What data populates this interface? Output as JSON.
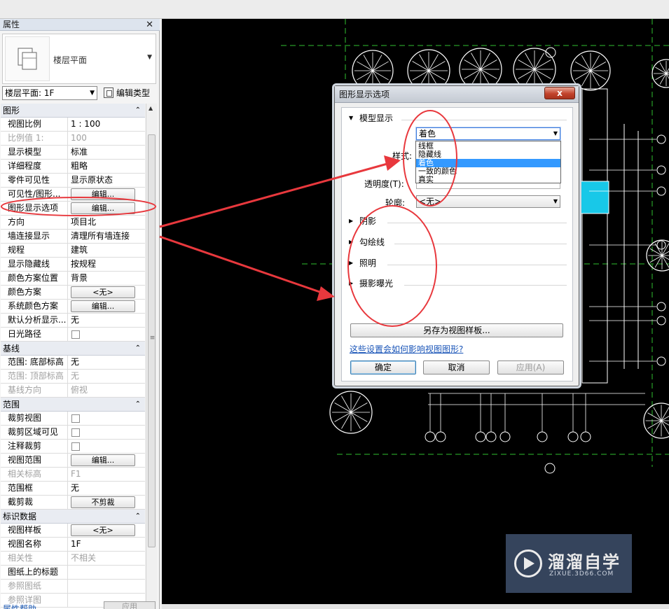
{
  "properties": {
    "title": "属性",
    "type_name": "楼层平面",
    "view_selector": "楼层平面: 1F",
    "edit_type_label": "编辑类型",
    "sections": [
      {
        "title": "图形",
        "rows": [
          {
            "label": "视图比例",
            "value": "1 : 100"
          },
          {
            "label": "比例值 1:",
            "value": "100",
            "disabled": true
          },
          {
            "label": "显示模型",
            "value": "标准"
          },
          {
            "label": "详细程度",
            "value": "粗略"
          },
          {
            "label": "零件可见性",
            "value": "显示原状态"
          },
          {
            "label": "可见性/图形...",
            "button": "编辑..."
          },
          {
            "label": "图形显示选项",
            "button": "编辑..."
          },
          {
            "label": "方向",
            "value": "项目北"
          },
          {
            "label": "墙连接显示",
            "value": "清理所有墙连接"
          },
          {
            "label": "规程",
            "value": "建筑"
          },
          {
            "label": "显示隐藏线",
            "value": "按规程"
          },
          {
            "label": "颜色方案位置",
            "value": "背景"
          },
          {
            "label": "颜色方案",
            "button": "<无>"
          },
          {
            "label": "系统颜色方案",
            "button": "编辑..."
          },
          {
            "label": "默认分析显示...",
            "value": "无"
          },
          {
            "label": "日光路径",
            "checkbox": true
          }
        ]
      },
      {
        "title": "基线",
        "rows": [
          {
            "label": "范围: 底部标高",
            "value": "无"
          },
          {
            "label": "范围: 顶部标高",
            "value": "无",
            "disabled": true
          },
          {
            "label": "基线方向",
            "value": "俯视",
            "disabled": true
          }
        ]
      },
      {
        "title": "范围",
        "rows": [
          {
            "label": "裁剪视图",
            "checkbox": true
          },
          {
            "label": "裁剪区域可见",
            "checkbox": true
          },
          {
            "label": "注释裁剪",
            "checkbox": true
          },
          {
            "label": "视图范围",
            "button": "编辑..."
          },
          {
            "label": "相关标高",
            "value": "F1",
            "disabled": true
          },
          {
            "label": "范围框",
            "value": "无"
          },
          {
            "label": "截剪裁",
            "button": "不剪裁"
          }
        ]
      },
      {
        "title": "标识数据",
        "rows": [
          {
            "label": "视图样板",
            "button": "<无>"
          },
          {
            "label": "视图名称",
            "value": "1F"
          },
          {
            "label": "相关性",
            "value": "不相关",
            "disabled": true
          },
          {
            "label": "图纸上的标题",
            "value": ""
          },
          {
            "label": "参照图纸",
            "value": "",
            "disabled": true
          },
          {
            "label": "参照详图",
            "value": "",
            "disabled": true
          }
        ]
      }
    ],
    "help_link": "属性帮助",
    "apply_label": "应用"
  },
  "dialog": {
    "title": "图形显示选项",
    "close_label": "x",
    "model_display_label": "模型显示",
    "style_label": "样式:",
    "style_value": "着色",
    "style_options": [
      "线框",
      "隐藏线",
      "着色",
      "一致的颜色",
      "真实"
    ],
    "style_selected_index": 2,
    "transparency_label": "透明度(T):",
    "outline_label": "轮廓:",
    "outline_value": "<无>",
    "groups": [
      "阴影",
      "勾绘线",
      "照明",
      "摄影曝光"
    ],
    "save_template_label": "另存为视图样板...",
    "help_link": "这些设置会如何影响视图图形?",
    "ok_label": "确定",
    "cancel_label": "取消",
    "apply_label": "应用(A)"
  },
  "watermark": {
    "title": "溜溜自学",
    "url": "ZIXUE.3D66.COM"
  },
  "colors": {
    "canvas_bg": "#000000",
    "annotation_red": "#e8383d",
    "grid_green": "#2fbf2f",
    "selection_blue": "#3399ff"
  }
}
